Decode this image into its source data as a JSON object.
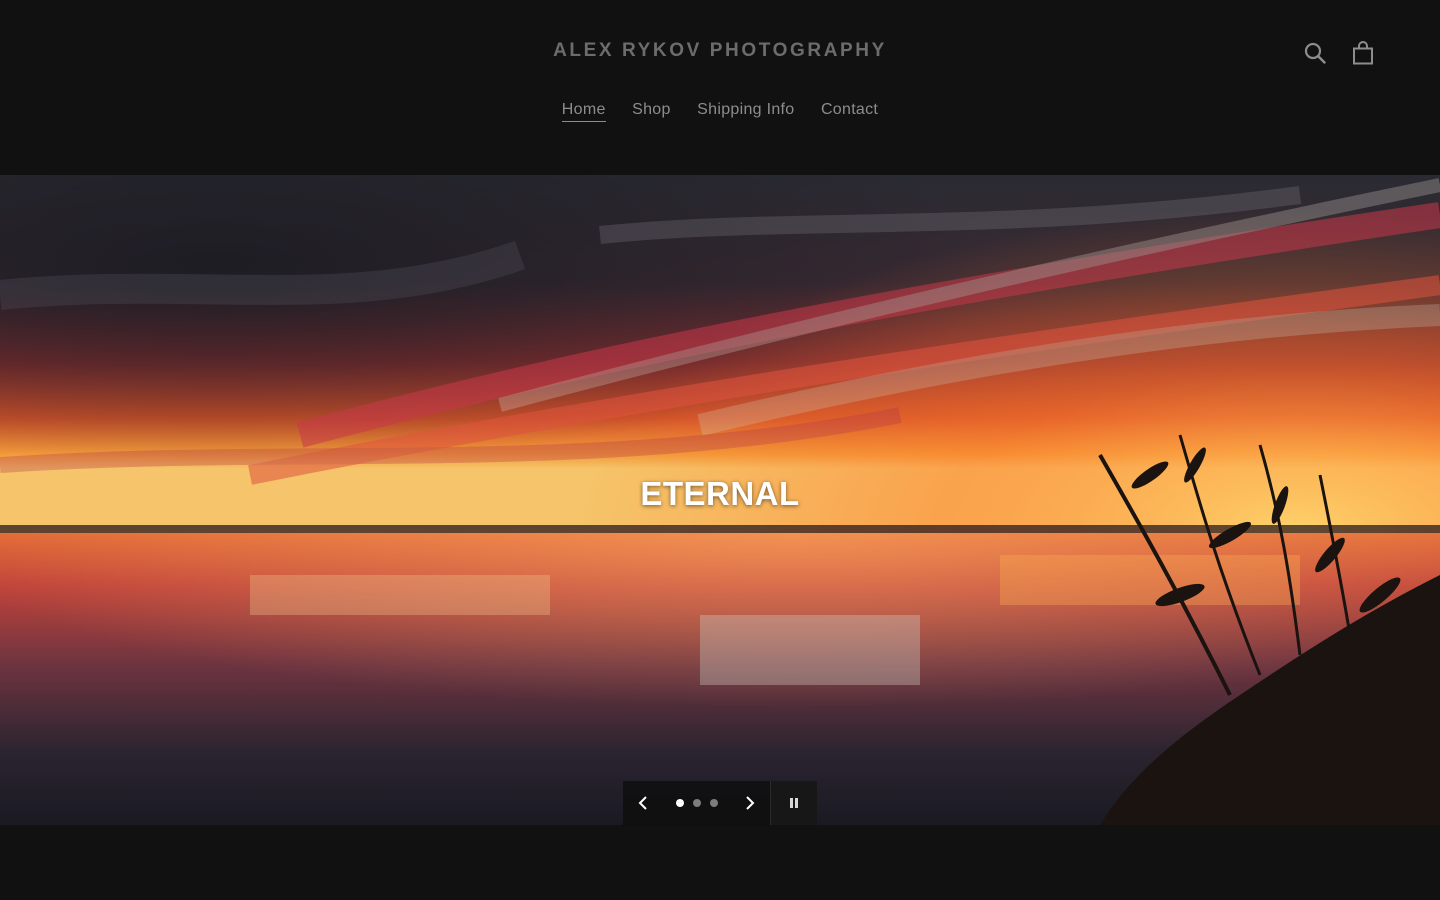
{
  "header": {
    "site_title": "ALEX RYKOV PHOTOGRAPHY",
    "icons": [
      "search-icon",
      "cart-icon"
    ],
    "nav": [
      {
        "label": "Home",
        "active": true
      },
      {
        "label": "Shop",
        "active": false
      },
      {
        "label": "Shipping Info",
        "active": false
      },
      {
        "label": "Contact",
        "active": false
      }
    ]
  },
  "slideshow": {
    "title": "ETERNAL",
    "slides_count": 3,
    "active_slide": 1,
    "controls": {
      "prev_icon": "chevron-left-icon",
      "next_icon": "chevron-right-icon",
      "pause_icon": "pause-icon"
    }
  },
  "colors": {
    "background": "#111112",
    "site_title": "#6c6c6e",
    "nav_text": "#8d8d90",
    "hero_title": "#ffffff"
  }
}
